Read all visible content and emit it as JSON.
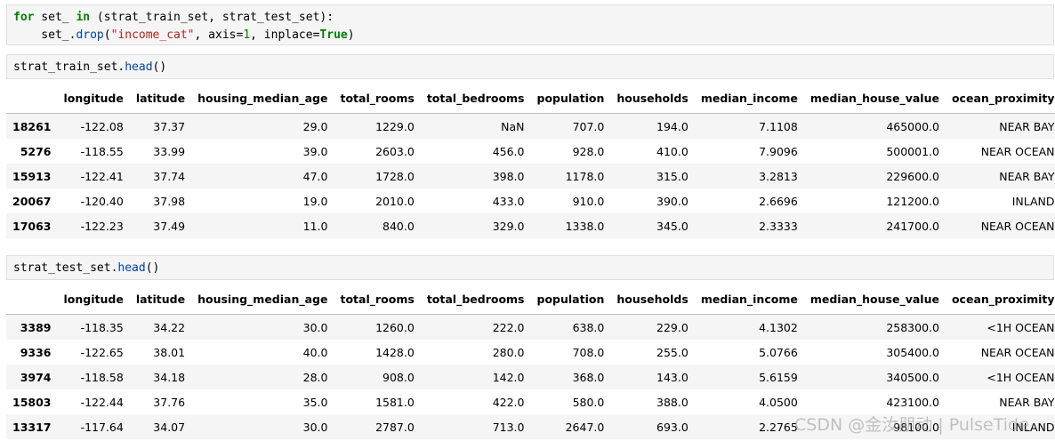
{
  "cell1": {
    "l1": {
      "kw_for": "for",
      "t1": " set_ ",
      "kw_in": "in",
      "t2": " (strat_train_set, strat_test_set):"
    },
    "l2": {
      "t1": "    set_.",
      "fn": "drop",
      "t2": "(",
      "str": "\"income_cat\"",
      "t3": ", axis=",
      "num": "1",
      "t4": ", inplace=",
      "kw": "True",
      "t5": ")"
    }
  },
  "cell2": {
    "t1": "strat_train_set.",
    "fn": "head",
    "t2": "()"
  },
  "cell3": {
    "t1": "strat_test_set.",
    "fn": "head",
    "t2": "()"
  },
  "columns": [
    "longitude",
    "latitude",
    "housing_median_age",
    "total_rooms",
    "total_bedrooms",
    "population",
    "households",
    "median_income",
    "median_house_value",
    "ocean_proximity"
  ],
  "train_rows": [
    {
      "index": "18261",
      "values": [
        "-122.08",
        "37.37",
        "29.0",
        "1229.0",
        "NaN",
        "707.0",
        "194.0",
        "7.1108",
        "465000.0",
        "NEAR BAY"
      ]
    },
    {
      "index": "5276",
      "values": [
        "-118.55",
        "33.99",
        "39.0",
        "2603.0",
        "456.0",
        "928.0",
        "410.0",
        "7.9096",
        "500001.0",
        "NEAR OCEAN"
      ]
    },
    {
      "index": "15913",
      "values": [
        "-122.41",
        "37.74",
        "47.0",
        "1728.0",
        "398.0",
        "1178.0",
        "315.0",
        "3.2813",
        "229600.0",
        "NEAR BAY"
      ]
    },
    {
      "index": "20067",
      "values": [
        "-120.40",
        "37.98",
        "19.0",
        "2010.0",
        "433.0",
        "910.0",
        "390.0",
        "2.6696",
        "121200.0",
        "INLAND"
      ]
    },
    {
      "index": "17063",
      "values": [
        "-122.23",
        "37.49",
        "11.0",
        "840.0",
        "329.0",
        "1338.0",
        "345.0",
        "2.3333",
        "241700.0",
        "NEAR OCEAN"
      ]
    }
  ],
  "test_rows": [
    {
      "index": "3389",
      "values": [
        "-118.35",
        "34.22",
        "30.0",
        "1260.0",
        "222.0",
        "638.0",
        "229.0",
        "4.1302",
        "258300.0",
        "<1H OCEAN"
      ]
    },
    {
      "index": "9336",
      "values": [
        "-122.65",
        "38.01",
        "40.0",
        "1428.0",
        "280.0",
        "708.0",
        "255.0",
        "5.0766",
        "305400.0",
        "NEAR OCEAN"
      ]
    },
    {
      "index": "3974",
      "values": [
        "-118.58",
        "34.18",
        "28.0",
        "908.0",
        "142.0",
        "368.0",
        "143.0",
        "5.6159",
        "340500.0",
        "<1H OCEAN"
      ]
    },
    {
      "index": "15803",
      "values": [
        "-122.44",
        "37.76",
        "35.0",
        "1581.0",
        "422.0",
        "580.0",
        "388.0",
        "4.0500",
        "423100.0",
        "NEAR BAY"
      ]
    },
    {
      "index": "13317",
      "values": [
        "-117.64",
        "34.07",
        "30.0",
        "2787.0",
        "713.0",
        "2647.0",
        "693.0",
        "2.2765",
        "98100.0",
        "INLAND"
      ]
    }
  ],
  "watermark": "CSDN @金汝朋动 | PulseTide"
}
